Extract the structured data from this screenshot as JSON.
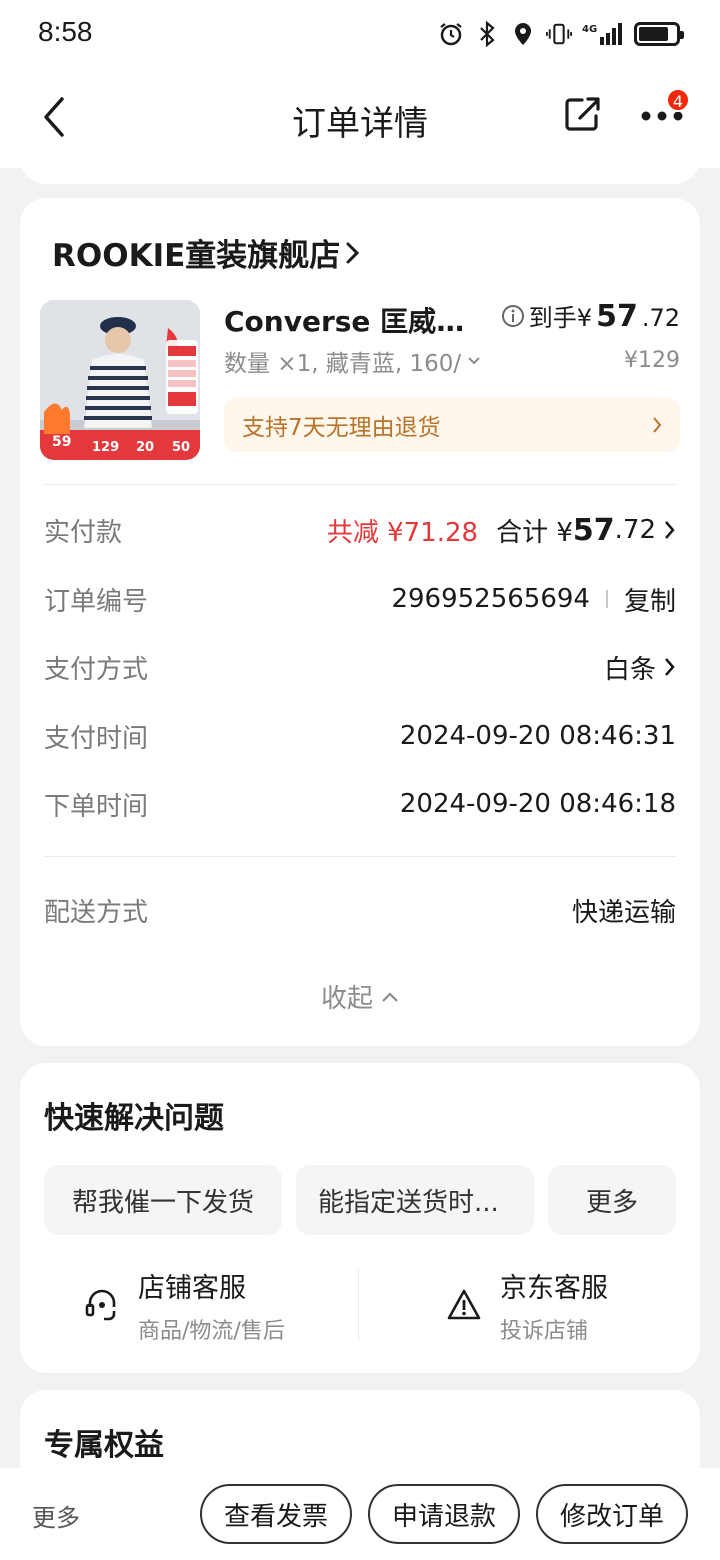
{
  "status_bar": {
    "time": "8:58",
    "icons": [
      "alarm-icon",
      "bluetooth-icon",
      "location-icon",
      "vibrate-icon",
      "signal-4g-icon",
      "battery-icon"
    ],
    "network_label": "4G"
  },
  "nav": {
    "title": "订单详情",
    "badge_count": "4"
  },
  "order": {
    "shop_name": "ROOKIE童装旗舰店",
    "product": {
      "title": "Converse 匡威童...",
      "spec": "数量 ×1, 藏青蓝, 160/",
      "final_price_prefix": "到手¥",
      "final_price_int": "57",
      "final_price_dec": ".72",
      "original_price": "¥129",
      "image_tags": {
        "left_badge": "59",
        "prices": [
          "129",
          "20",
          "50"
        ]
      }
    },
    "return_policy": "支持7天无理由退货",
    "payment_row": {
      "label": "实付款",
      "discount": "共减 ¥71.28",
      "total_prefix": "合计 ¥",
      "total_int": "57",
      "total_dec": ".72"
    },
    "order_no_row": {
      "label": "订单编号",
      "value": "296952565694",
      "copy": "复制"
    },
    "pay_method_row": {
      "label": "支付方式",
      "value": "白条"
    },
    "pay_time_row": {
      "label": "支付时间",
      "value": "2024-09-20 08:46:31"
    },
    "order_time_row": {
      "label": "下单时间",
      "value": "2024-09-20 08:46:18"
    },
    "delivery_row": {
      "label": "配送方式",
      "value": "快递运输"
    },
    "collapse_label": "收起"
  },
  "quick": {
    "title": "快速解决问题",
    "chips": [
      "帮我催一下发货",
      "能指定送货时...",
      "更多"
    ],
    "shop_service": {
      "title": "店铺客服",
      "subtitle": "商品/物流/售后"
    },
    "jd_service": {
      "title": "京东客服",
      "subtitle": "投诉店铺"
    }
  },
  "rights": {
    "title": "专属权益"
  },
  "bottom": {
    "more": "更多",
    "buttons": [
      "查看发票",
      "申请退款",
      "修改订单"
    ]
  },
  "colors": {
    "accent_red": "#e4393c",
    "badge_red": "#f2270c",
    "return_text": "#b8742a",
    "return_bg": "#fff6ec"
  }
}
